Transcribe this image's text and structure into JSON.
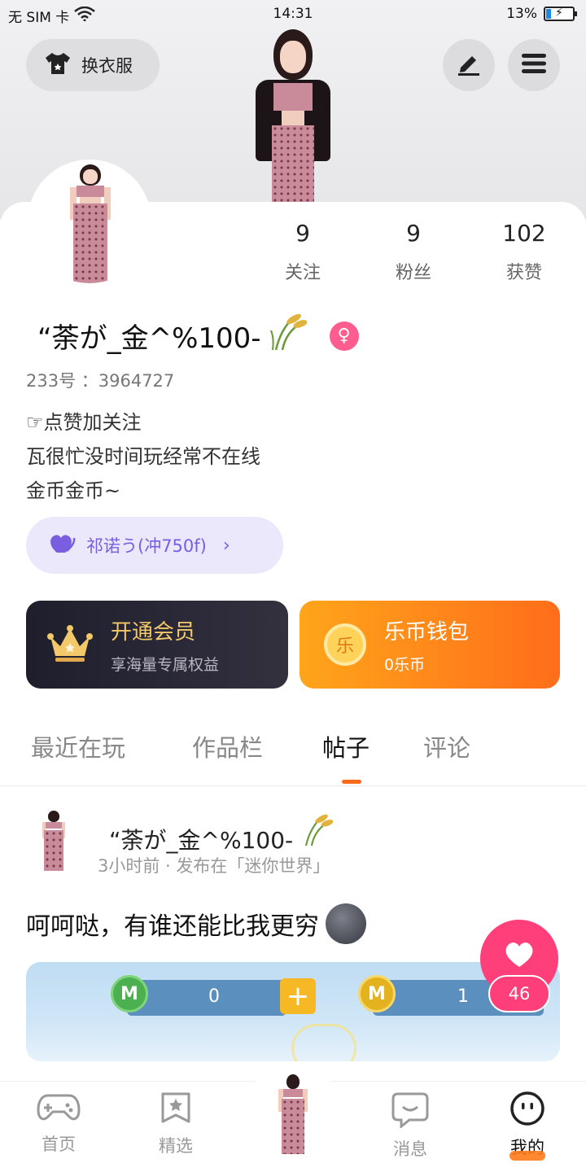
{
  "status_bar": {
    "carrier": "无 SIM 卡",
    "time": "14:31",
    "battery": "13%"
  },
  "header": {
    "dress_button_label": "换衣服",
    "icons": [
      "tshirt-icon",
      "edit-icon",
      "menu-icon"
    ]
  },
  "stats": [
    {
      "value": "9",
      "label": "关注"
    },
    {
      "value": "9",
      "label": "粉丝"
    },
    {
      "value": "102",
      "label": "获赞"
    }
  ],
  "profile": {
    "username": "“荼が_金^%100-",
    "gender_symbol": "♀",
    "id_label": "233号 ：3964727",
    "bio": [
      "☞点赞加关注",
      "瓦很忙没时间玩经常不在线",
      "金币金币~"
    ],
    "badge_label": "祁诺う(冲750f)"
  },
  "vip": {
    "title": "开通会员",
    "subtitle": "享海量专属权益"
  },
  "wallet": {
    "title": "乐币钱包",
    "subtitle": "0乐币",
    "coin_glyph": "乐"
  },
  "tabs": [
    "最近在玩",
    "作品栏",
    "帖子",
    "评论"
  ],
  "active_tab": "帖子",
  "post": {
    "author": "“荼が_金^%100-",
    "meta": "3小时前 · 发布在「迷你世界」",
    "text": "呵呵哒，有谁还能比我更穷",
    "image": {
      "green_coin_value": "0",
      "gold_coin_value": "1",
      "coin_letter": "M"
    },
    "like_count": "46"
  },
  "bottom_nav": [
    {
      "label": "首页",
      "icon": "gamepad-icon"
    },
    {
      "label": "精选",
      "icon": "star-icon"
    },
    {
      "label": "",
      "icon": "avatar"
    },
    {
      "label": "消息",
      "icon": "chat-icon"
    },
    {
      "label": "我的",
      "icon": "smiley-icon"
    }
  ],
  "colors": {
    "accent": "#ff6a1a",
    "like": "#ff3f7a",
    "badge": "#7a5ee0",
    "vip_gold": "#f3c86b"
  }
}
